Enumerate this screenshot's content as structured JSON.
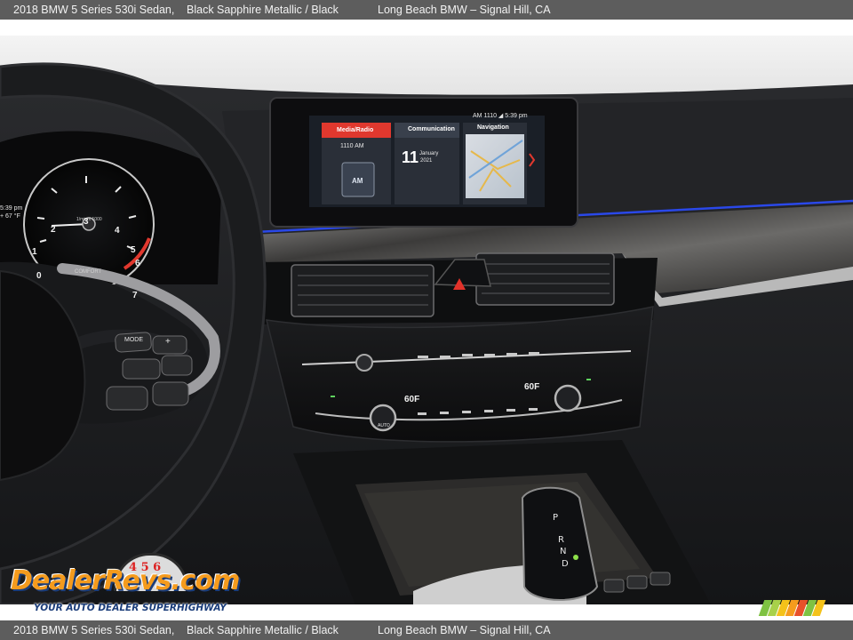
{
  "caption": {
    "vehicle": "2018 BMW 5 Series 530i Sedan,",
    "color": "Black Sapphire Metallic / Black",
    "dealer": "Long Beach BMW – Signal Hill, CA"
  },
  "screen": {
    "status": "AM 1110 ◢  5:39 pm",
    "tiles": [
      {
        "label": "Media/Radio",
        "station": "1110 AM",
        "badge": "AM"
      },
      {
        "label": "Communication",
        "day": "11",
        "month": "January",
        "year": "2021"
      },
      {
        "label": "Navigation"
      }
    ]
  },
  "cluster": {
    "time": "5:39 pm",
    "temp": "+ 67 °F",
    "mode": "COMFORT",
    "unit": "1/min x 1000",
    "ticks": [
      "0",
      "1",
      "2",
      "3",
      "4",
      "5",
      "6",
      "7"
    ]
  },
  "climate": {
    "left_temp": "60F",
    "right_temp": "60F",
    "auto": "AUTO"
  },
  "wheel_buttons": {
    "mode": "MODE",
    "plus": "+"
  },
  "watermark": {
    "logo": "DealerRevs.com",
    "tagline": "YOUR AUTO DEALER SUPERHIGHWAY",
    "wheel_digits": "4 5 6"
  },
  "colors": {
    "caption_bg": "#5d5d5d",
    "ambient_light": "#2b4cff",
    "media_tile": "#e0382e",
    "logo_orange": "#f59b1d",
    "logo_blue": "#1b3d7a",
    "stripes": [
      "#7ec242",
      "#a8d14a",
      "#f4c21a",
      "#f59b1d",
      "#e8502a",
      "#7ec242",
      "#f4c21a"
    ]
  }
}
